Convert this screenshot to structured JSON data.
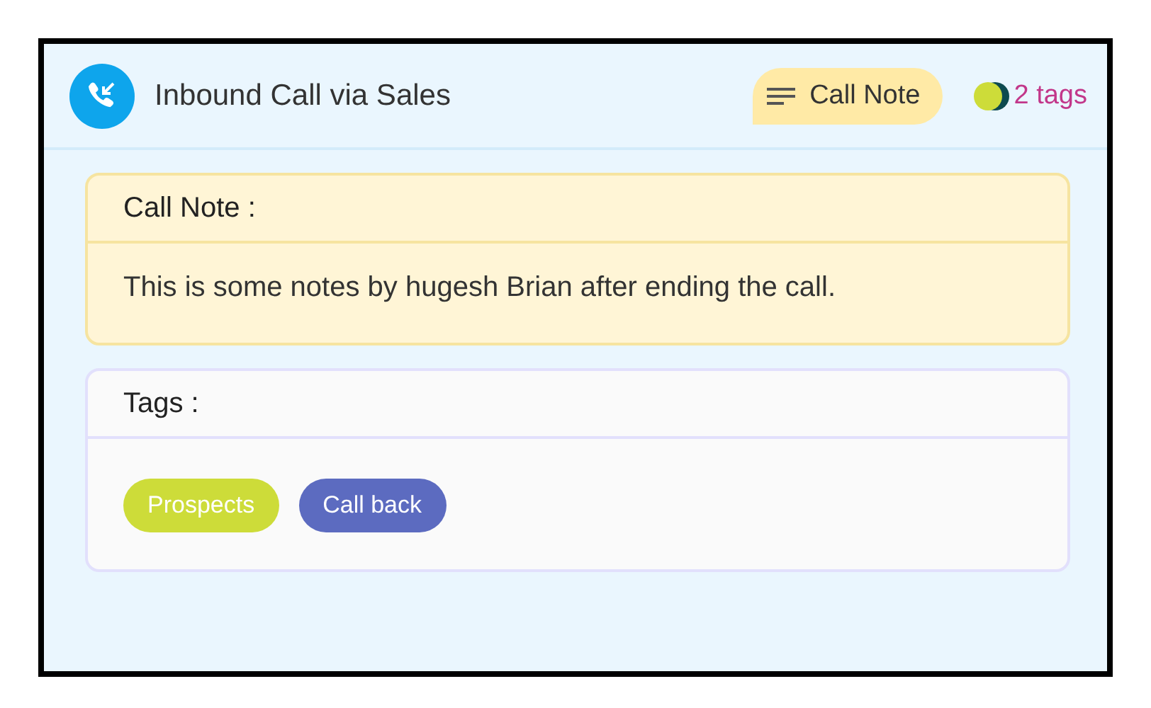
{
  "header": {
    "title": "Inbound Call via Sales",
    "note_button": "Call Note",
    "tag_count": "2 tags"
  },
  "note": {
    "heading": "Call Note :",
    "text": "This is some notes by hugesh Brian after ending the call."
  },
  "tags": {
    "heading": "Tags :",
    "items": [
      {
        "label": "Prospects",
        "color": "#cddc39"
      },
      {
        "label": "Call back",
        "color": "#5c6bc0"
      }
    ]
  }
}
